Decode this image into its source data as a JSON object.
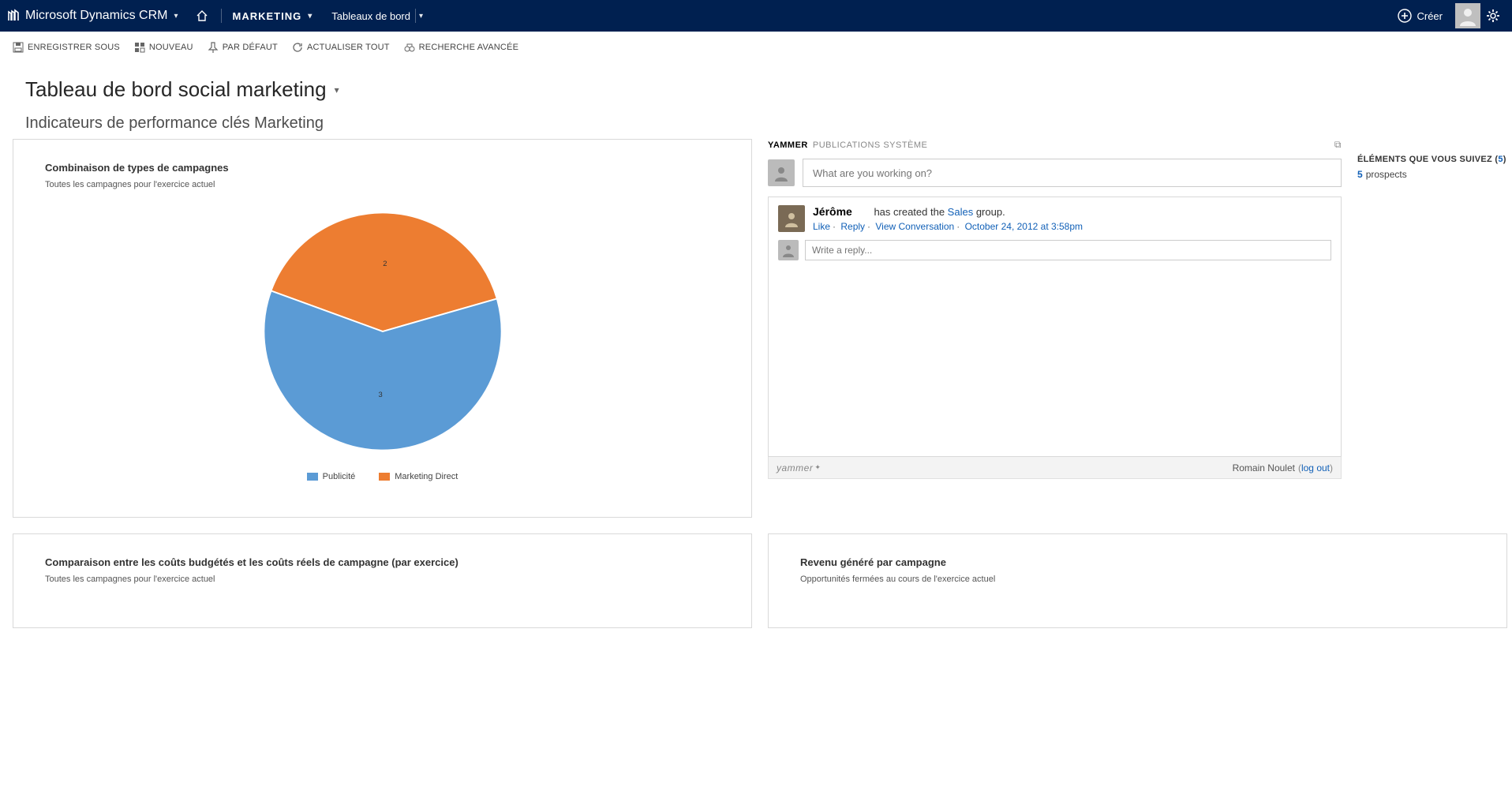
{
  "topnav": {
    "brand": "Microsoft Dynamics CRM",
    "module": "MARKETING",
    "sub": "Tableaux de bord",
    "create": "Créer"
  },
  "cmdbar": {
    "saveas": "ENREGISTRER SOUS",
    "new": "NOUVEAU",
    "default": "PAR DÉFAUT",
    "refresh": "ACTUALISER TOUT",
    "advfind": "RECHERCHE AVANCÉE"
  },
  "page": {
    "title": "Tableau de bord social marketing",
    "subtitle": "Indicateurs de performance clés Marketing"
  },
  "panel1": {
    "title": "Combinaison de types de campagnes",
    "sub": "Toutes les campagnes pour l'exercice actuel"
  },
  "panel2": {
    "title": "Comparaison entre les coûts budgétés et les coûts réels de campagne (par exercice)",
    "sub": "Toutes les campagnes pour l'exercice actuel"
  },
  "panel3": {
    "title": "Revenu généré par campagne",
    "sub": "Opportunités fermées au cours de l'exercice actuel"
  },
  "yammer": {
    "tab1": "YAMMER",
    "tab2": "PUBLICATIONS SYSTÈME",
    "compose_placeholder": "What are you working on?",
    "post": {
      "name": "Jérôme",
      "text_pre": "has created the ",
      "text_link": "Sales",
      "text_post": " group.",
      "like": "Like",
      "reply": "Reply",
      "view": "View Conversation",
      "ts": "October 24, 2012 at 3:58pm"
    },
    "reply_placeholder": "Write a reply...",
    "footer_brand": "yammer",
    "footer_user": "Romain Noulet",
    "footer_logout": "log out"
  },
  "follow": {
    "title_pre": "ÉLÉMENTS QUE VOUS SUIVEZ (",
    "count": "5",
    "title_post": ")",
    "line_count": "5",
    "line_label": "prospects"
  },
  "chart_data": {
    "type": "pie",
    "title": "Combinaison de types de campagnes",
    "series": [
      {
        "name": "Publicité",
        "value": 3,
        "color": "#5b9bd5"
      },
      {
        "name": "Marketing Direct",
        "value": 2,
        "color": "#ed7d31"
      }
    ]
  }
}
